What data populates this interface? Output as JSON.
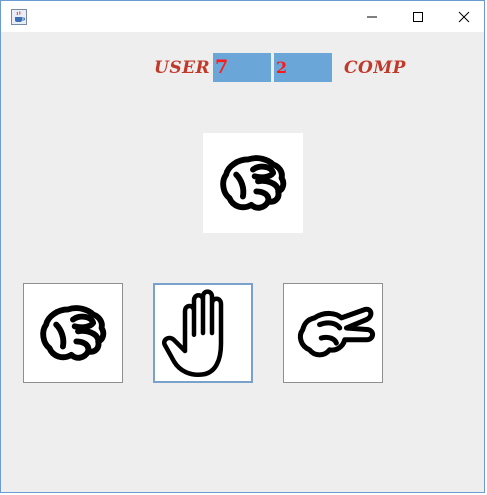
{
  "window": {
    "icon": "java-coffee-icon",
    "controls": [
      "minimize-icon",
      "maximize-icon",
      "close-icon"
    ]
  },
  "score": {
    "user_label": "USER",
    "user_value": "7",
    "comp_value": "2",
    "comp_label": "COMP",
    "label_color": "#c0392b",
    "value_color": "#ff1a1a",
    "field_bg": "#6aa6d8"
  },
  "computer_choice": {
    "icon": "rock-fist-icon"
  },
  "choices": [
    {
      "name": "rock",
      "icon": "rock-fist-icon"
    },
    {
      "name": "paper",
      "icon": "paper-open-hand-icon",
      "focused": true
    },
    {
      "name": "scissors",
      "icon": "scissors-hand-icon"
    }
  ]
}
